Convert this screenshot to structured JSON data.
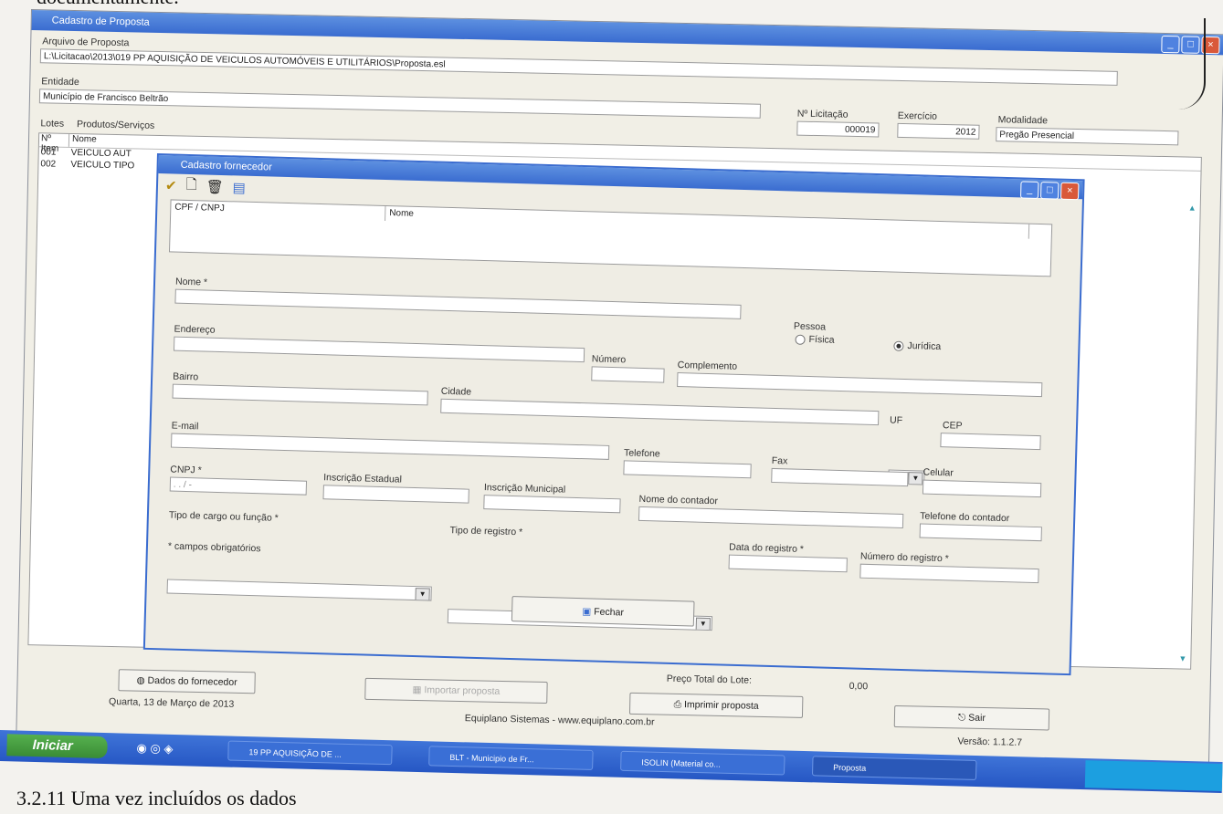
{
  "doc": {
    "top_text": "documentamente.",
    "bottom_text": "3.2.11 Uma vez incluídos os dados"
  },
  "main_window": {
    "title": "Cadastro de Proposta",
    "arquivo_label": "Arquivo de Proposta",
    "arquivo_value": "L:\\Licitacao\\2013\\019 PP AQUISIÇÃO DE VEICULOS AUTOMÓVEIS E UTILITÁRIOS\\Proposta.esl",
    "entidade_label": "Entidade",
    "entidade_value": "Município de Francisco Beltrão",
    "licitacao_label": "Nº Licitação",
    "licitacao_value": "000019",
    "exercicio_label": "Exercício",
    "exercicio_value": "2012",
    "modalidade_label": "Modalidade",
    "modalidade_value": "Pregão Presencial",
    "tabs": [
      "Lotes",
      "Produtos/Serviços"
    ],
    "list_headers": [
      "Nº Item",
      "Nome"
    ],
    "list_rows": [
      {
        "item": "001",
        "nome": "VEICULO AUT"
      },
      {
        "item": "002",
        "nome": "VEICULO TIPO"
      }
    ],
    "btn_dados": "Dados do fornecedor",
    "btn_disabled": "Importar proposta",
    "btn_imprimir": "Imprimir proposta",
    "btn_sair": "Sair",
    "preco_label": "Preço Total do Lote:",
    "preco_value": "0,00",
    "date": "Quarta, 13 de Março de 2013",
    "footer_company": "Equiplano Sistemas - www.equiplano.com.br",
    "version": "Versão: 1.1.2.7"
  },
  "dialog": {
    "title": "Cadastro fornecedor",
    "grid_headers": [
      "CPF / CNPJ",
      "Nome"
    ],
    "nome_label": "Nome *",
    "pessoa_label": "Pessoa",
    "fisica_label": "Física",
    "juridica_label": "Jurídica",
    "endereco_label": "Endereço",
    "numero_label": "Número",
    "complemento_label": "Complemento",
    "bairro_label": "Bairro",
    "cidade_label": "Cidade",
    "uf_label": "UF",
    "cep_label": "CEP",
    "email_label": "E-mail",
    "telefone_label": "Telefone",
    "fax_label": "Fax",
    "celular_label": "Celular",
    "cnpj_label": "CNPJ *",
    "cnpj_mask": "  .   .   /    -",
    "inscricao_estadual_label": "Inscrição Estadual",
    "inscricao_municipal_label": "Inscrição Municipal",
    "nome_contador_label": "Nome do contador",
    "telefone_contador_label": "Telefone do contador",
    "tipo_cargo_label": "Tipo de cargo ou função *",
    "tipo_registro_label": "Tipo de registro *",
    "data_registro_label": "Data do registro *",
    "numero_registro_label": "Número do registro *",
    "obrigatorios": "* campos obrigatórios",
    "fechar_label": "Fechar"
  },
  "taskbar": {
    "start_label": "Iniciar",
    "tasks": [
      "19 PP AQUISIÇÃO DE ...",
      "BLT - Municipio de Fr...",
      "ISOLIN (Material co...",
      "Proposta"
    ],
    "tray_text": ""
  },
  "colors": {
    "title_blue": "#3a6cd0",
    "start_green": "#3a8c35",
    "close_red": "#d9593a"
  }
}
